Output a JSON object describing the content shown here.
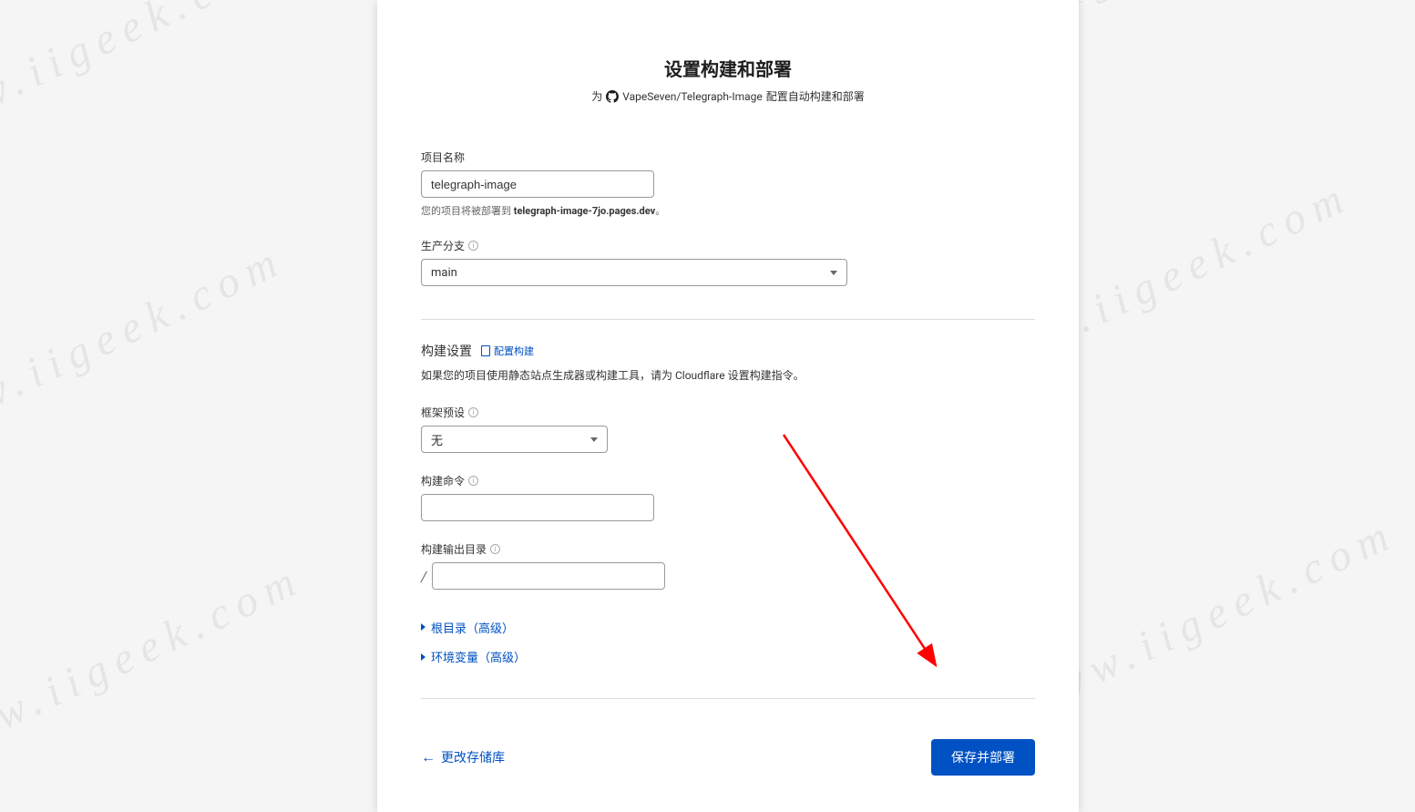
{
  "watermark": "www.iigeek.com",
  "header": {
    "title": "设置构建和部署",
    "subtitle_prefix": "为",
    "repo": "VapeSeven/Telegraph-Image",
    "subtitle_suffix": "配置自动构建和部署"
  },
  "project_name": {
    "label": "项目名称",
    "value": "telegraph-image",
    "hint_prefix": "您的项目将被部署到 ",
    "hint_domain": "telegraph-image-7jo.pages.dev",
    "hint_suffix": "。"
  },
  "production_branch": {
    "label": "生产分支",
    "value": "main"
  },
  "build_settings": {
    "title": "构建设置",
    "docs_link": "配置构建",
    "description": "如果您的项目使用静态站点生成器或构建工具，请为 Cloudflare 设置构建指令。"
  },
  "framework_preset": {
    "label": "框架预设",
    "value": "无"
  },
  "build_command": {
    "label": "构建命令",
    "value": ""
  },
  "build_output": {
    "label": "构建输出目录",
    "prefix": "/",
    "value": ""
  },
  "expandables": {
    "root_dir": "根目录（高级）",
    "env_vars": "环境变量（高级）"
  },
  "footer": {
    "back": "更改存储库",
    "submit": "保存并部署"
  }
}
